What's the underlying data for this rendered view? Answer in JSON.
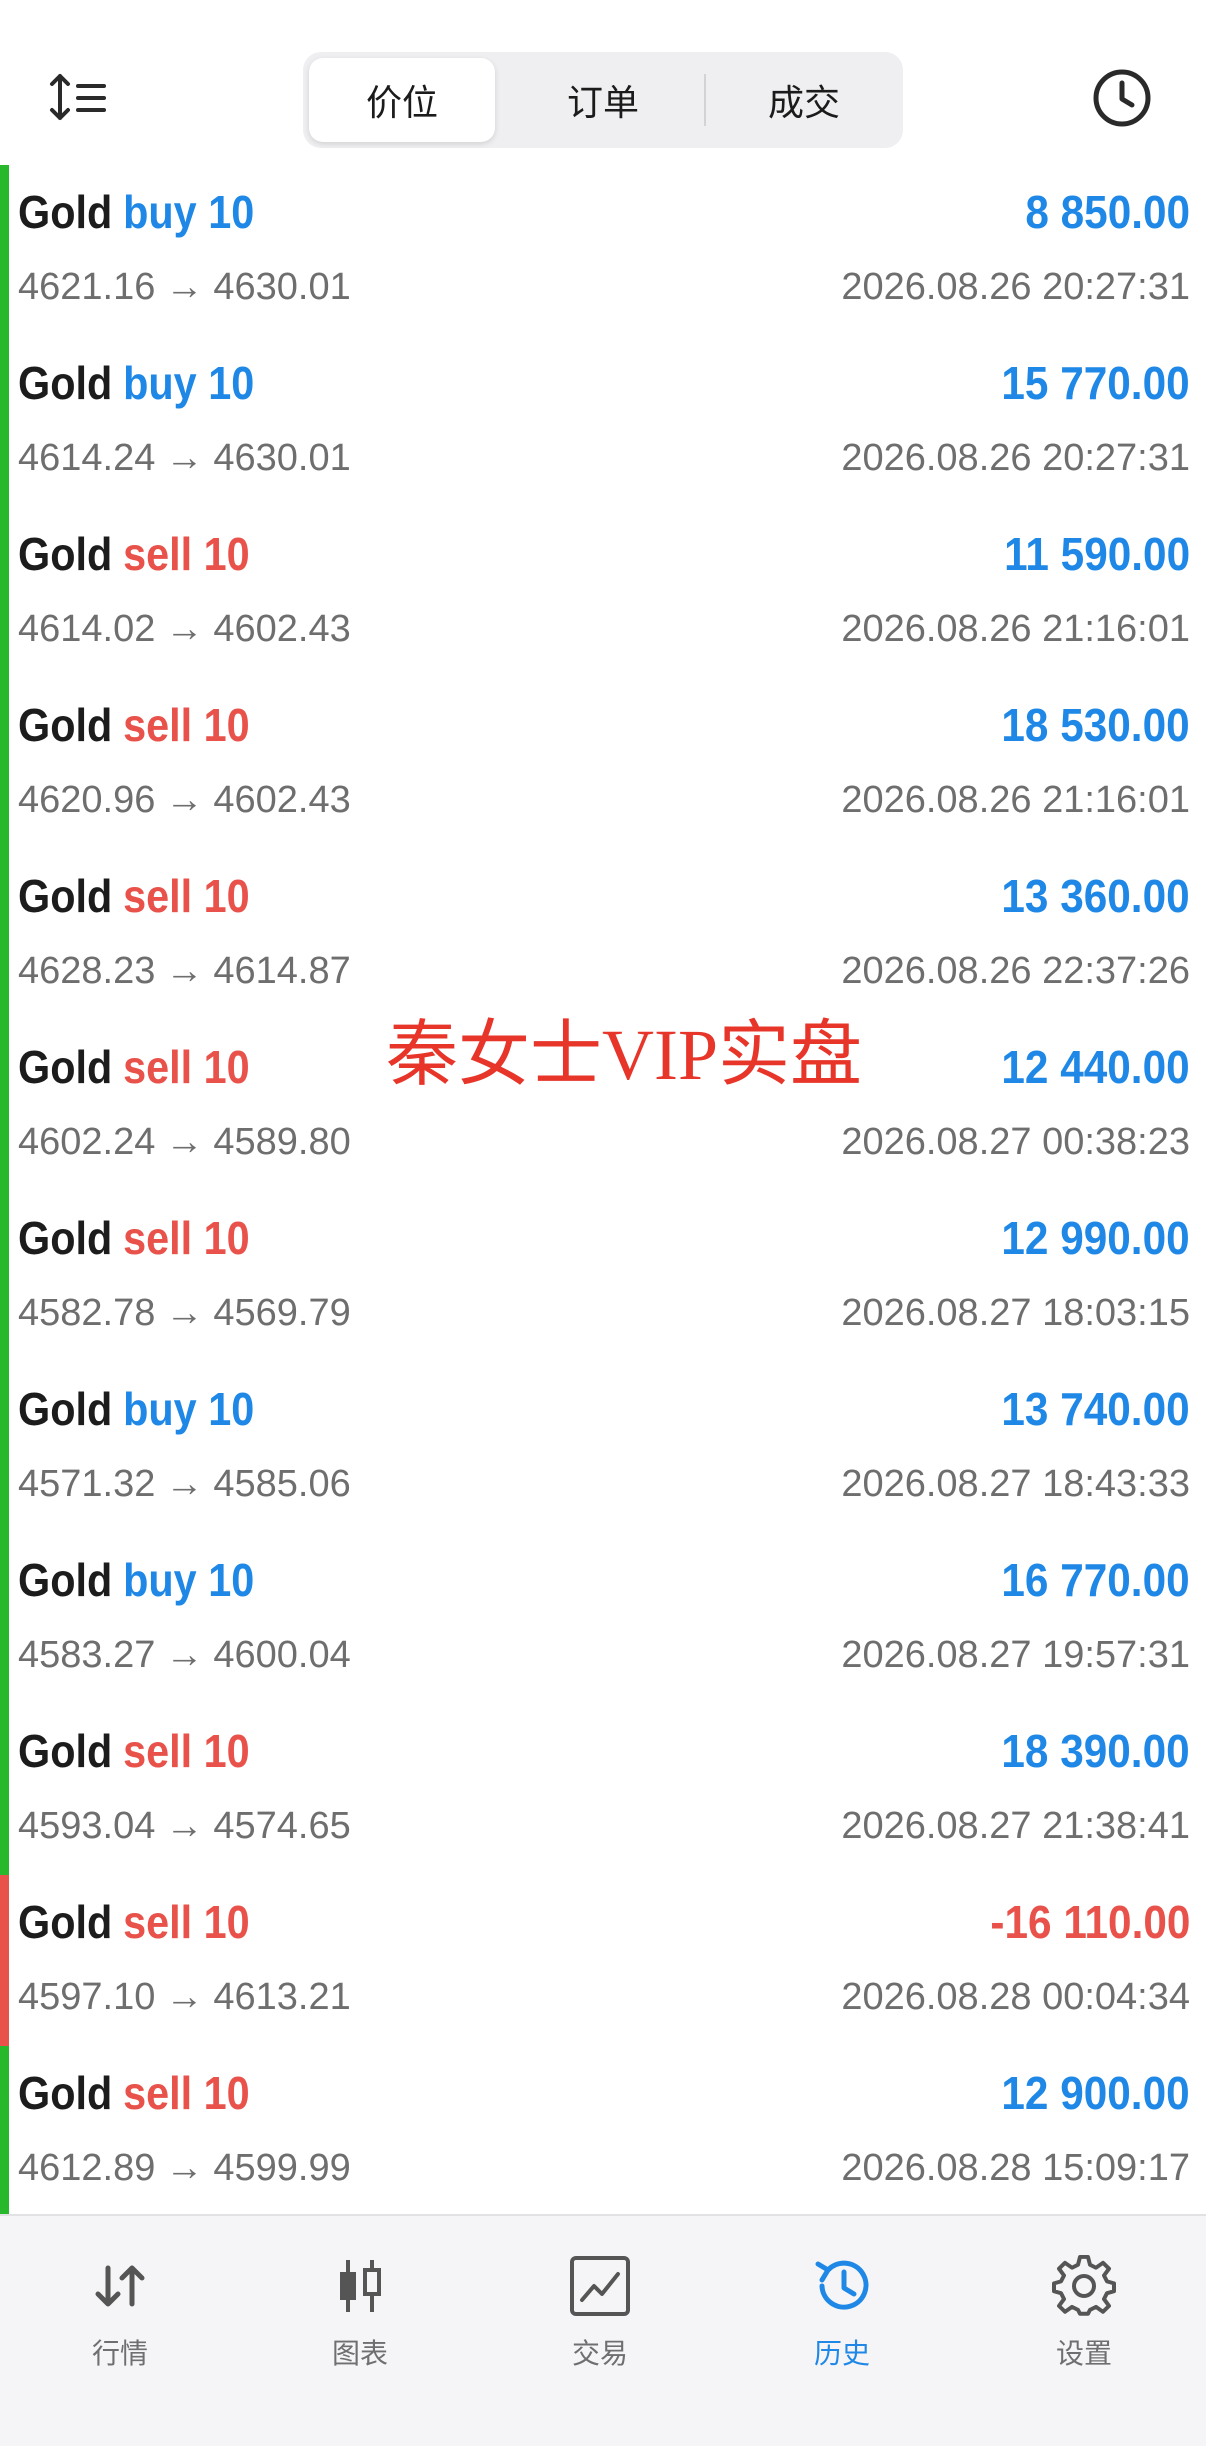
{
  "header": {
    "tabs": [
      {
        "label": "价位",
        "active": true
      },
      {
        "label": "订单",
        "active": false
      },
      {
        "label": "成交",
        "active": false
      }
    ],
    "left_icon": "sort-icon",
    "right_icon": "clock-icon"
  },
  "deals": [
    {
      "symbol": "Gold",
      "side": "buy 10",
      "type": "buy",
      "open": "4621.16",
      "close": "4630.01",
      "profit": "8 850.00",
      "time": "2026.08.26 20:27:31"
    },
    {
      "symbol": "Gold",
      "side": "buy 10",
      "type": "buy",
      "open": "4614.24",
      "close": "4630.01",
      "profit": "15 770.00",
      "time": "2026.08.26 20:27:31"
    },
    {
      "symbol": "Gold",
      "side": "sell 10",
      "type": "sell",
      "open": "4614.02",
      "close": "4602.43",
      "profit": "11 590.00",
      "time": "2026.08.26 21:16:01"
    },
    {
      "symbol": "Gold",
      "side": "sell 10",
      "type": "sell",
      "open": "4620.96",
      "close": "4602.43",
      "profit": "18 530.00",
      "time": "2026.08.26 21:16:01"
    },
    {
      "symbol": "Gold",
      "side": "sell 10",
      "type": "sell",
      "open": "4628.23",
      "close": "4614.87",
      "profit": "13 360.00",
      "time": "2026.08.26 22:37:26"
    },
    {
      "symbol": "Gold",
      "side": "sell 10",
      "type": "sell",
      "open": "4602.24",
      "close": "4589.80",
      "profit": "12 440.00",
      "time": "2026.08.27 00:38:23"
    },
    {
      "symbol": "Gold",
      "side": "sell 10",
      "type": "sell",
      "open": "4582.78",
      "close": "4569.79",
      "profit": "12 990.00",
      "time": "2026.08.27 18:03:15"
    },
    {
      "symbol": "Gold",
      "side": "buy 10",
      "type": "buy",
      "open": "4571.32",
      "close": "4585.06",
      "profit": "13 740.00",
      "time": "2026.08.27 18:43:33"
    },
    {
      "symbol": "Gold",
      "side": "buy 10",
      "type": "buy",
      "open": "4583.27",
      "close": "4600.04",
      "profit": "16 770.00",
      "time": "2026.08.27 19:57:31"
    },
    {
      "symbol": "Gold",
      "side": "sell 10",
      "type": "sell",
      "open": "4593.04",
      "close": "4574.65",
      "profit": "18 390.00",
      "time": "2026.08.27 21:38:41"
    },
    {
      "symbol": "Gold",
      "side": "sell 10",
      "type": "sell",
      "open": "4597.10",
      "close": "4613.21",
      "profit": "-16 110.00",
      "time": "2026.08.28 00:04:34",
      "loss": true
    },
    {
      "symbol": "Gold",
      "side": "sell 10",
      "type": "sell",
      "open": "4612.89",
      "close": "4599.99",
      "profit": "12 900.00",
      "time": "2026.08.28 15:09:17"
    }
  ],
  "arrow": "→",
  "watermark": "秦女士VIP实盘",
  "tabbar": {
    "tabs": [
      {
        "label": "行情",
        "icon": "quotes-icon",
        "active": false
      },
      {
        "label": "图表",
        "icon": "chart-icon",
        "active": false
      },
      {
        "label": "交易",
        "icon": "trade-icon",
        "active": false
      },
      {
        "label": "历史",
        "icon": "history-icon",
        "active": true
      },
      {
        "label": "设置",
        "icon": "settings-icon",
        "active": false
      }
    ]
  },
  "colors": {
    "accent": "#1f88e6",
    "sell": "#e8524a",
    "profit_bar": "#27b82b",
    "loss_bar": "#e8524a",
    "watermark": "#e8352a"
  }
}
